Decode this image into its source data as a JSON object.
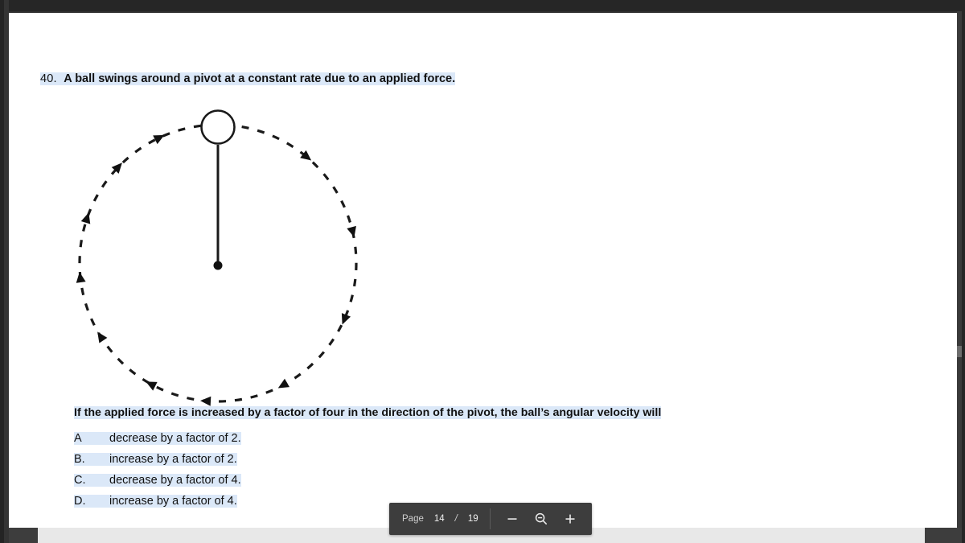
{
  "document": {
    "question_number": "40.",
    "question_title": "A ball swings around a pivot at a constant rate due to an applied force.",
    "question_prompt": "If the applied force is increased by a factor of four in the direction of the pivot, the ball’s angular velocity will",
    "answers": [
      {
        "letter": "A",
        "text": "decrease by a factor of 2."
      },
      {
        "letter": "B.",
        "text": "increase by a factor of 2."
      },
      {
        "letter": "C.",
        "text": "decrease by a factor of 4."
      },
      {
        "letter": "D.",
        "text": "increase by a factor of 4."
      }
    ],
    "highlight_color": "#dbe8f8"
  },
  "diagram": {
    "name": "ball-swinging-around-pivot",
    "description": "Dashed circular path with clockwise arrowheads, a ball at the top connected by a rod to a pivot dot at the center",
    "ball_label": "",
    "pivot_label": "",
    "path_style": "dashed",
    "rotation_direction": "clockwise",
    "arrowhead_count": 12
  },
  "toolbar": {
    "page_label": "Page",
    "current_page": "14",
    "separator": "/",
    "total_pages": "19",
    "zoom_out_label": "−",
    "zoom_reset_icon": "magnifier-minus-icon",
    "zoom_in_label": "+"
  }
}
